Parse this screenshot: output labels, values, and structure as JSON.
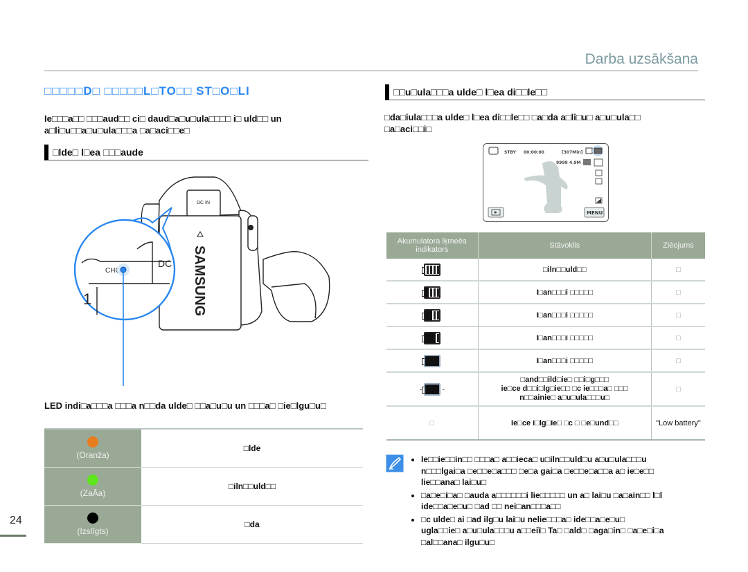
{
  "page": {
    "header": "Darba uzsākšana",
    "page_number": "24"
  },
  "left": {
    "title": "□□□□□D□ □□□□□L□TO□□ ST□O□LI",
    "intro_lines": [
      "Ie□□□a□□ □□□aud□□ ci□ daud□a□u□ula□□□□ i□ uld□□ un",
      "a□li□u□□a□u□ula□□□a □a□aci□□e□"
    ],
    "section_heading": "□lde□ l□ea □□□aude",
    "illustration": {
      "label_chg": "CHG",
      "label_dc_in": "DC IN",
      "label_dc": "DC",
      "brand": "SAMSUNG",
      "highlight_color": "#2a87f0"
    },
    "led_caption": "LED indi□a□□□a □□□a n□□da ulde□ □□a□u□u un □□□a□ □ie□lgu□u□",
    "led_table": [
      {
        "color_name": "(Oranža)",
        "color": "#e87d1e",
        "status": "□lde"
      },
      {
        "color_name": "(ZaĀa)",
        "color": "#5ee61a",
        "status": "□iln□□uld□□"
      },
      {
        "color_name": "(Izslīgts)",
        "color": "#000000",
        "status": "□da"
      }
    ]
  },
  "right": {
    "section_heading": "□□u□ula□□□a ulde□ l□ea di□□le□□",
    "intro_lines": [
      "□da□iula□□□a ulde□ l□ea di□□le□□ □a□da a□li□u□ a□u□ula□□",
      "□a□aci□□i□"
    ],
    "lcd": {
      "mode": "STBY",
      "timecode": "00:00:00",
      "remaining": "[307Min]",
      "count": "9999",
      "resolution": "4.9M",
      "menu_label": "MENU",
      "play_icon": "play-icon"
    },
    "battery_table": {
      "headers": [
        "Akumulatora lķmeēa indikators",
        "Stāvoklis",
        "Ziēojums"
      ],
      "rows": [
        {
          "level": 1.0,
          "blink": false,
          "icon": "battery-full-icon",
          "status": "□iln□□uld□□",
          "message": "□"
        },
        {
          "level": 0.75,
          "blink": false,
          "icon": "battery-75-icon",
          "status": "I□an□□□i □□□□□",
          "message": "□"
        },
        {
          "level": 0.5,
          "blink": false,
          "icon": "battery-50-icon",
          "status": "I□an□□□i □□□□□",
          "message": "□"
        },
        {
          "level": 0.25,
          "blink": false,
          "icon": "battery-25-icon",
          "status": "I□an□□□i □□□□□",
          "message": "□"
        },
        {
          "level": 0.0,
          "blink": false,
          "icon": "battery-empty-icon",
          "status": "I□an□□□i □□□□□",
          "message": "□"
        },
        {
          "level": 0.0,
          "blink": true,
          "icon": "battery-blinking-icon",
          "status_lines": [
            "□and□□ild□ie□ □□i□g□□□",
            "ie□ce d□□i□lg□ie□□ □c ie□□□a□ □□□",
            "n□□ainie□ a□u□ula□□□u□"
          ],
          "message": "□"
        },
        {
          "level": null,
          "blink": false,
          "icon": "none",
          "icon_text": "□",
          "status": "Ie□ce i□lg□ie□ □c □ □e□und□□",
          "message": "\"Low battery\""
        }
      ]
    },
    "notes": [
      [
        "Ie□□ie□□in□□ □□□a□ a□□ieca□ u□iln□□uld□u a□u□ula□□□u",
        "n□□□lgai□a □e□□e□a□□□ □e□a gai□a □e□□e□a□□a a□ ie□e□□",
        "lie□□ana□ lai□u□"
      ],
      [
        "□a□e□i□a□ □auda a□□□□□□i lie□□□□□ un a□ lai□u □a□ain□□ l□l",
        "ide□□a□e□u□ □ad □□ nei□an□□□a□□"
      ],
      [
        "□c ulde□ ai □ad ilg□u lai□u nelie□□□a□ ide□□a□e□u□",
        "ugla□□ie□ a□u□ula□□□u a□□eiī□ Ta□ □ald□ □aga□in□ □a□e□i□a",
        "□al□□ana□ ilgu□u□"
      ]
    ]
  }
}
